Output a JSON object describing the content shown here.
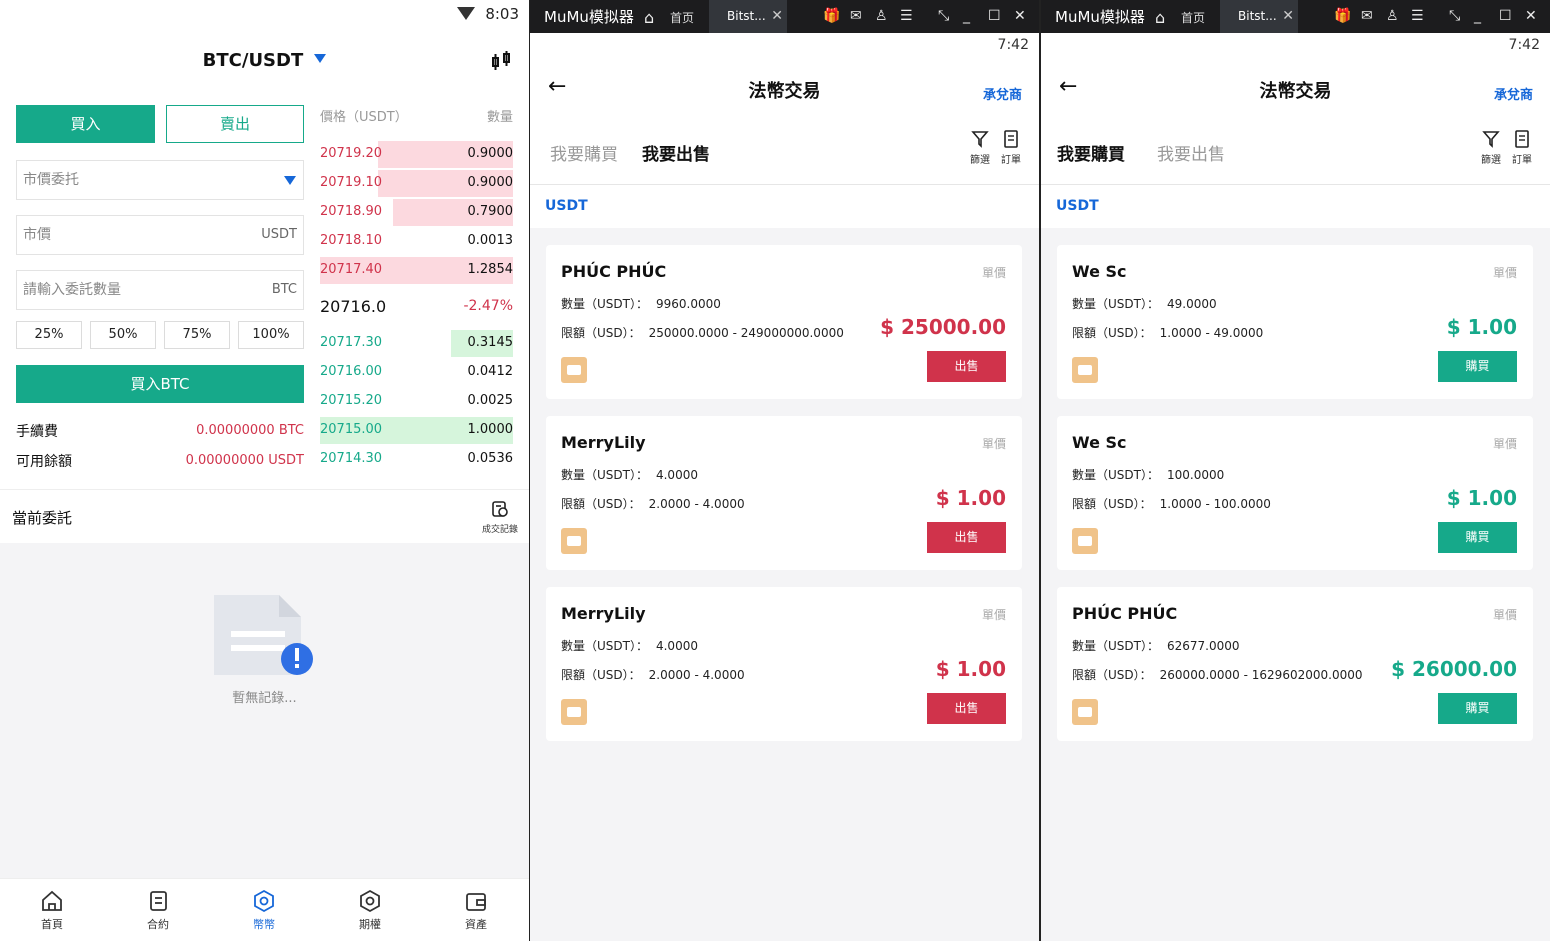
{
  "left": {
    "status_time": "8:03",
    "pair": "BTC/USDT",
    "buy_tab": "買入",
    "sell_tab": "賣出",
    "order_type": "市價委托",
    "price_field": "市價",
    "price_unit": "USDT",
    "qty_placeholder": "請輸入委託數量",
    "qty_unit": "BTC",
    "pcts": [
      "25%",
      "50%",
      "75%",
      "100%"
    ],
    "buy_button": "買入BTC",
    "fee_label": "手續費",
    "fee_value": "0.00000000 BTC",
    "balance_label": "可用餘額",
    "balance_value": "0.00000000 USDT",
    "ob_header_price": "價格（USDT）",
    "ob_header_qty": "數量",
    "asks": [
      {
        "price": "20719.20",
        "qty": "0.9000",
        "depth": 0.7
      },
      {
        "price": "20719.10",
        "qty": "0.9000",
        "depth": 0.7
      },
      {
        "price": "20718.90",
        "qty": "0.7900",
        "depth": 0.62
      },
      {
        "price": "20718.10",
        "qty": "0.0013",
        "depth": 0
      },
      {
        "price": "20717.40",
        "qty": "1.2854",
        "depth": 1.0
      }
    ],
    "last_price": "20716.0",
    "change": "-2.47%",
    "bids": [
      {
        "price": "20717.30",
        "qty": "0.3145",
        "depth": 0.32
      },
      {
        "price": "20716.00",
        "qty": "0.0412",
        "depth": 0
      },
      {
        "price": "20715.20",
        "qty": "0.0025",
        "depth": 0
      },
      {
        "price": "20715.00",
        "qty": "1.0000",
        "depth": 1.0
      },
      {
        "price": "20714.30",
        "qty": "0.0536",
        "depth": 0
      }
    ],
    "current_orders": "當前委託",
    "trade_records": "成交記錄",
    "empty_text": "暫無記錄...",
    "nav": [
      "首頁",
      "合約",
      "幣幣",
      "期權",
      "資產"
    ]
  },
  "emulator": {
    "title": "MuMu模拟器",
    "home": "首页",
    "tab": "Bitst..."
  },
  "middle": {
    "status_time": "7:42",
    "title": "法幣交易",
    "merchant": "承兌商",
    "tab_buy": "我要購買",
    "tab_sell": "我要出售",
    "filter": "篩選",
    "orders": "訂單",
    "currency": "USDT",
    "cards": [
      {
        "name": "PHÚC PHÚC",
        "unit": "單價",
        "qty_label": "數量（USDT）：",
        "qty": "9960.0000",
        "limit_label": "限額（USD）：",
        "limit": "250000.0000 - 249000000.0000",
        "price": "$ 25000.00",
        "action": "出售"
      },
      {
        "name": "MerryLily",
        "unit": "單價",
        "qty_label": "數量（USDT）：",
        "qty": "4.0000",
        "limit_label": "限額（USD）：",
        "limit": "2.0000 - 4.0000",
        "price": "$ 1.00",
        "action": "出售"
      },
      {
        "name": "MerryLily",
        "unit": "單價",
        "qty_label": "數量（USDT）：",
        "qty": "4.0000",
        "limit_label": "限額（USD）：",
        "limit": "2.0000 - 4.0000",
        "price": "$ 1.00",
        "action": "出售"
      }
    ]
  },
  "right": {
    "status_time": "7:42",
    "title": "法幣交易",
    "merchant": "承兌商",
    "tab_buy": "我要購買",
    "tab_sell": "我要出售",
    "filter": "篩選",
    "orders": "訂單",
    "currency": "USDT",
    "cards": [
      {
        "name": "We Sc",
        "unit": "單價",
        "qty_label": "數量（USDT）：",
        "qty": "49.0000",
        "limit_label": "限額（USD）：",
        "limit": "1.0000 - 49.0000",
        "price": "$ 1.00",
        "action": "購買"
      },
      {
        "name": "We Sc",
        "unit": "單價",
        "qty_label": "數量（USDT）：",
        "qty": "100.0000",
        "limit_label": "限額（USD）：",
        "limit": "1.0000 - 100.0000",
        "price": "$ 1.00",
        "action": "購買"
      },
      {
        "name": "PHÚC PHÚC",
        "unit": "單價",
        "qty_label": "數量（USDT）：",
        "qty": "62677.0000",
        "limit_label": "限額（USD）：",
        "limit": "260000.0000 - 1629602000.0000",
        "price": "$ 26000.00",
        "action": "購買"
      }
    ]
  },
  "colors": {
    "green": "#16a98a",
    "red": "#d0334b",
    "blue": "#1667d8"
  }
}
